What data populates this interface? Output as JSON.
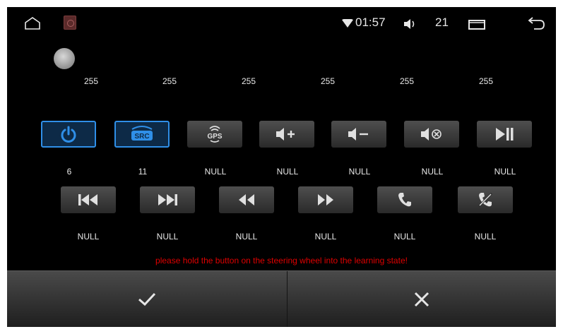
{
  "status_bar": {
    "time": "01:57",
    "volume": "21",
    "icons": [
      "home-icon",
      "app-icon",
      "wifi-icon",
      "volume-icon",
      "recent-apps-icon",
      "back-icon"
    ]
  },
  "top_values": [
    "255",
    "255",
    "255",
    "255",
    "255",
    "255"
  ],
  "row1": [
    {
      "icon": "power-icon",
      "value": "6",
      "active": true
    },
    {
      "icon": "src-icon",
      "label": "SRC",
      "value": "11",
      "active": true
    },
    {
      "icon": "gps-icon",
      "label": "GPS",
      "value": "NULL",
      "active": false
    },
    {
      "icon": "volume-up-icon",
      "value": "NULL",
      "active": false
    },
    {
      "icon": "volume-down-icon",
      "value": "NULL",
      "active": false
    },
    {
      "icon": "mute-icon",
      "value": "NULL",
      "active": false
    },
    {
      "icon": "play-pause-icon",
      "value": "NULL",
      "active": false
    }
  ],
  "row2": [
    {
      "icon": "previous-track-icon",
      "value": "NULL"
    },
    {
      "icon": "next-track-icon",
      "value": "NULL"
    },
    {
      "icon": "rewind-icon",
      "value": "NULL"
    },
    {
      "icon": "fast-forward-icon",
      "value": "NULL"
    },
    {
      "icon": "call-answer-icon",
      "value": "NULL"
    },
    {
      "icon": "call-hangup-icon",
      "value": "NULL"
    }
  ],
  "hint": "please hold the button on the steering wheel into the learning state!",
  "colors": {
    "accent": "#2f8fe8",
    "warning": "#e00000"
  },
  "bottom_bar": {
    "confirm_icon": "checkmark-icon",
    "cancel_icon": "close-icon"
  }
}
